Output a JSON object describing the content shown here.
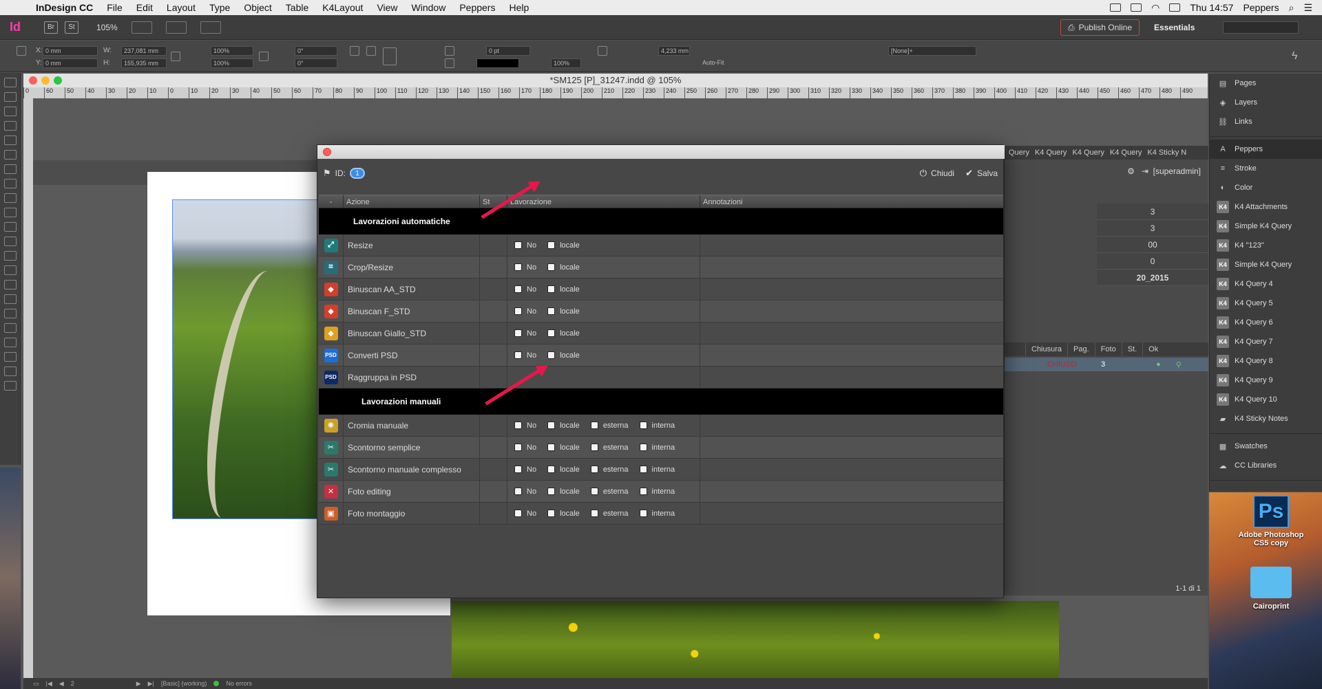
{
  "menubar": {
    "app": "InDesign CC",
    "items": [
      "File",
      "Edit",
      "Layout",
      "Type",
      "Object",
      "Table",
      "K4Layout",
      "View",
      "Window",
      "Peppers",
      "Help"
    ],
    "clock": "Thu 14:57",
    "user": "Peppers"
  },
  "appbar": {
    "logo": "Id",
    "br": "Br",
    "st": "St",
    "zoom": "105%",
    "publish": "Publish Online",
    "workspace": "Essentials"
  },
  "controlbar": {
    "x": "0 mm",
    "y": "0 mm",
    "w": "237,081 mm",
    "h": "155,935 mm",
    "scale_x": "100%",
    "scale_y": "100%",
    "rotate": "0°",
    "shear": "0°",
    "stroke": "0 pt",
    "opacity": "100%",
    "dim": "4,233 mm",
    "autofit": "Auto-Fit",
    "style": "[None]+"
  },
  "document": {
    "title": "*SM125 [P]_31247.indd @ 105%",
    "ruler": [
      "0",
      "60",
      "50",
      "40",
      "30",
      "20",
      "10",
      "0",
      "10",
      "20",
      "30",
      "40",
      "50",
      "60",
      "70",
      "80",
      "90",
      "100",
      "110",
      "120",
      "130",
      "140",
      "150",
      "160",
      "170",
      "180",
      "190",
      "200",
      "210",
      "220",
      "230",
      "240",
      "250",
      "260",
      "270",
      "280",
      "290",
      "300",
      "310",
      "320",
      "330",
      "340",
      "350",
      "360",
      "370",
      "380",
      "390",
      "400",
      "410",
      "420",
      "430",
      "440",
      "450",
      "460",
      "470",
      "480",
      "490"
    ]
  },
  "k4panel": {
    "tabs": [
      "Query",
      "K4 Query",
      "K4 Query",
      "K4 Query",
      "K4 Sticky N"
    ],
    "user": "[superadmin]",
    "values": [
      "3",
      "3",
      "00",
      "0",
      "20_2015"
    ],
    "columns": [
      "Chiusura",
      "Pag.",
      "Foto",
      "St.",
      "Ok"
    ],
    "row": {
      "chiusura": "CHIUSO",
      "pag": "3"
    },
    "footer": "1-1 di 1"
  },
  "panels": {
    "group1": [
      {
        "icon": "pages-icon",
        "label": "Pages"
      },
      {
        "icon": "layers-icon",
        "label": "Layers"
      },
      {
        "icon": "links-icon",
        "label": "Links"
      }
    ],
    "group2": [
      {
        "icon": "peppers-icon",
        "label": "Peppers"
      },
      {
        "icon": "stroke-icon",
        "label": "Stroke"
      },
      {
        "icon": "color-icon",
        "label": "Color"
      },
      {
        "icon": "k4-icon",
        "label": "K4 Attachments"
      },
      {
        "icon": "k4-icon",
        "label": "Simple K4 Query"
      },
      {
        "icon": "k4-icon",
        "label": "K4 \"123\""
      },
      {
        "icon": "k4-icon",
        "label": "Simple K4 Query"
      },
      {
        "icon": "k4-icon",
        "label": "K4 Query  4"
      },
      {
        "icon": "k4-icon",
        "label": "K4 Query  5"
      },
      {
        "icon": "k4-icon",
        "label": "K4 Query  6"
      },
      {
        "icon": "k4-icon",
        "label": "K4 Query  7"
      },
      {
        "icon": "k4-icon",
        "label": "K4 Query  8"
      },
      {
        "icon": "k4-icon",
        "label": "K4 Query  9"
      },
      {
        "icon": "k4-icon",
        "label": "K4 Query  10"
      },
      {
        "icon": "sticky-icon",
        "label": "K4 Sticky Notes"
      }
    ],
    "group3": [
      {
        "icon": "swatches-icon",
        "label": "Swatches"
      },
      {
        "icon": "libraries-icon",
        "label": "CC Libraries"
      }
    ]
  },
  "desktop": {
    "photoshop": "Adobe Photoshop CS5 copy",
    "ps_glyph": "Ps",
    "folder": "Cairoprint"
  },
  "statusbar": {
    "page": "2",
    "style": "[Basic] (working)",
    "errors": "No errors"
  },
  "dialog": {
    "id_label": "ID:",
    "id_value": "1",
    "close_label": "Chiudi",
    "save_label": "Salva",
    "columns": {
      "dash": "-",
      "azione": "Azione",
      "st": "St",
      "lavorazione": "Lavorazione",
      "annotazioni": "Annotazioni"
    },
    "section_auto": "Lavorazioni automatiche",
    "section_manual": "Lavorazioni manuali",
    "option_labels": {
      "no": "No",
      "locale": "locale",
      "esterna": "esterna",
      "interna": "interna"
    },
    "auto_rows": [
      {
        "name": "Resize",
        "icon": "resize-icon",
        "color": "#1f7a7a",
        "glyph": "⤢"
      },
      {
        "name": "Crop/Resize",
        "icon": "crop-icon",
        "color": "#2a6b7a",
        "glyph": "⌗"
      },
      {
        "name": "Binuscan AA_STD",
        "icon": "binuscan-icon",
        "color": "#d43f2a",
        "glyph": "◆"
      },
      {
        "name": "Binuscan F_STD",
        "icon": "binuscan-icon",
        "color": "#d43f2a",
        "glyph": "◆"
      },
      {
        "name": "Binuscan Giallo_STD",
        "icon": "binuscan-icon",
        "color": "#e0a020",
        "glyph": "◆"
      },
      {
        "name": "Converti PSD",
        "icon": "psd-icon",
        "color": "#1c6fd8",
        "glyph": "PSD"
      },
      {
        "name": "Raggruppa in PSD",
        "icon": "psd-group-icon",
        "color": "#0b2a66",
        "glyph": "PSD"
      }
    ],
    "manual_rows": [
      {
        "name": "Cromia manuale",
        "icon": "cromia-icon",
        "color": "#c9a227",
        "glyph": "✺"
      },
      {
        "name": "Scontorno semplice",
        "icon": "scissors-icon",
        "color": "#2a7a6b",
        "glyph": "✂"
      },
      {
        "name": "Scontorno manuale complesso",
        "icon": "scissors-icon",
        "color": "#2a7a6b",
        "glyph": "✂"
      },
      {
        "name": "Foto editing",
        "icon": "foto-editing-icon",
        "color": "#c43040",
        "glyph": "✕"
      },
      {
        "name": "Foto montaggio",
        "icon": "foto-montaggio-icon",
        "color": "#c9602a",
        "glyph": "▣"
      }
    ]
  }
}
